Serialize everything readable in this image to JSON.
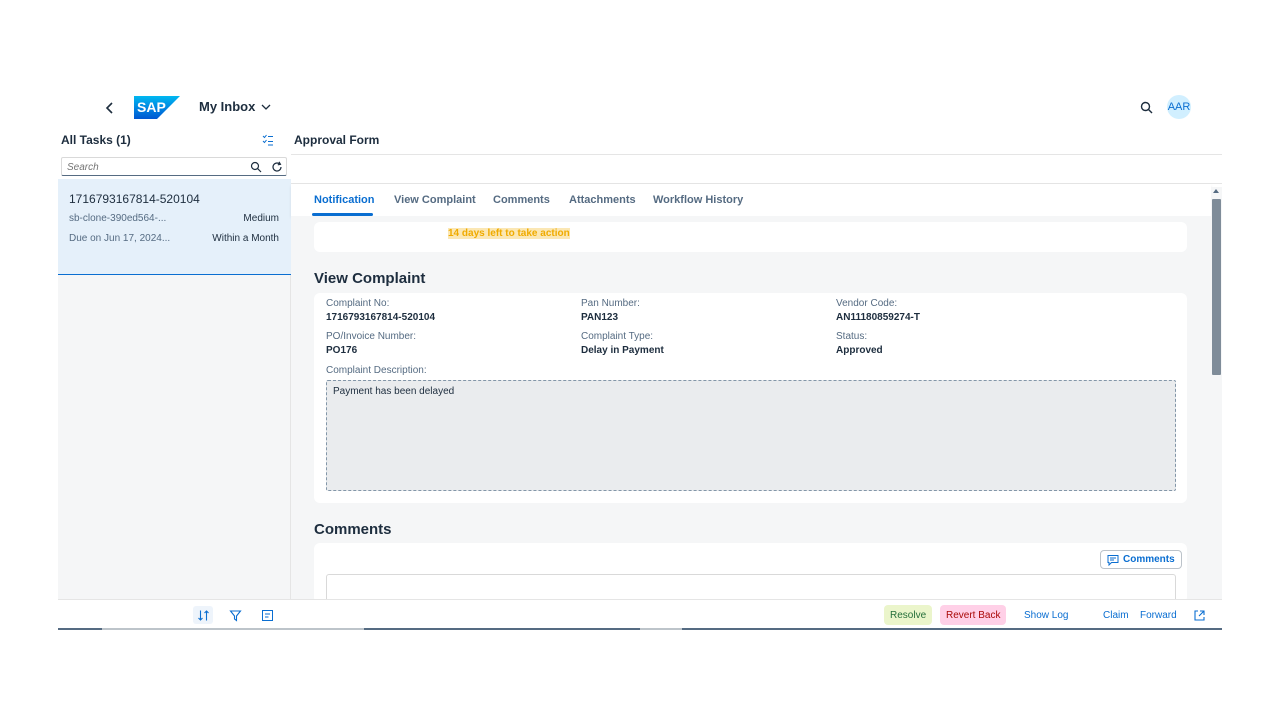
{
  "shell": {
    "app_title": "My Inbox",
    "logo_text": "SAP",
    "user_initials": "AAR"
  },
  "master": {
    "title": "All Tasks (1)",
    "search_placeholder": "Search",
    "task": {
      "id": "1716793167814-520104",
      "subtitle": "sb-clone-390ed564-...",
      "priority": "Medium",
      "due": "Due on Jun 17, 2024...",
      "within": "Within a Month"
    }
  },
  "detail": {
    "title": "Approval Form",
    "tabs": [
      "Notification",
      "View Complaint",
      "Comments",
      "Attachments",
      "Workflow History"
    ],
    "notice": "14 days left to take action",
    "view_complaint": {
      "heading": "View Complaint",
      "fields": {
        "complaint_no_label": "Complaint No:",
        "complaint_no": "1716793167814-520104",
        "pan_label": "Pan Number:",
        "pan": "PAN123",
        "vendor_label": "Vendor Code:",
        "vendor": "AN11180859274-T",
        "po_label": "PO/Invoice Number:",
        "po": "PO176",
        "type_label": "Complaint Type:",
        "type": "Delay in Payment",
        "status_label": "Status:",
        "status": "Approved",
        "desc_label": "Complaint Description:",
        "desc": "Payment has been delayed"
      }
    },
    "comments": {
      "heading": "Comments",
      "button_label": "Comments"
    },
    "actions": {
      "resolve": "Resolve",
      "revert": "Revert Back",
      "show_log": "Show Log",
      "claim": "Claim",
      "forward": "Forward"
    }
  },
  "colors": {
    "brand": "#0a6ed1",
    "notice": "#f0ab00",
    "resolve_bg": "#ebf5cb",
    "revert_bg": "#ffd0e7"
  }
}
